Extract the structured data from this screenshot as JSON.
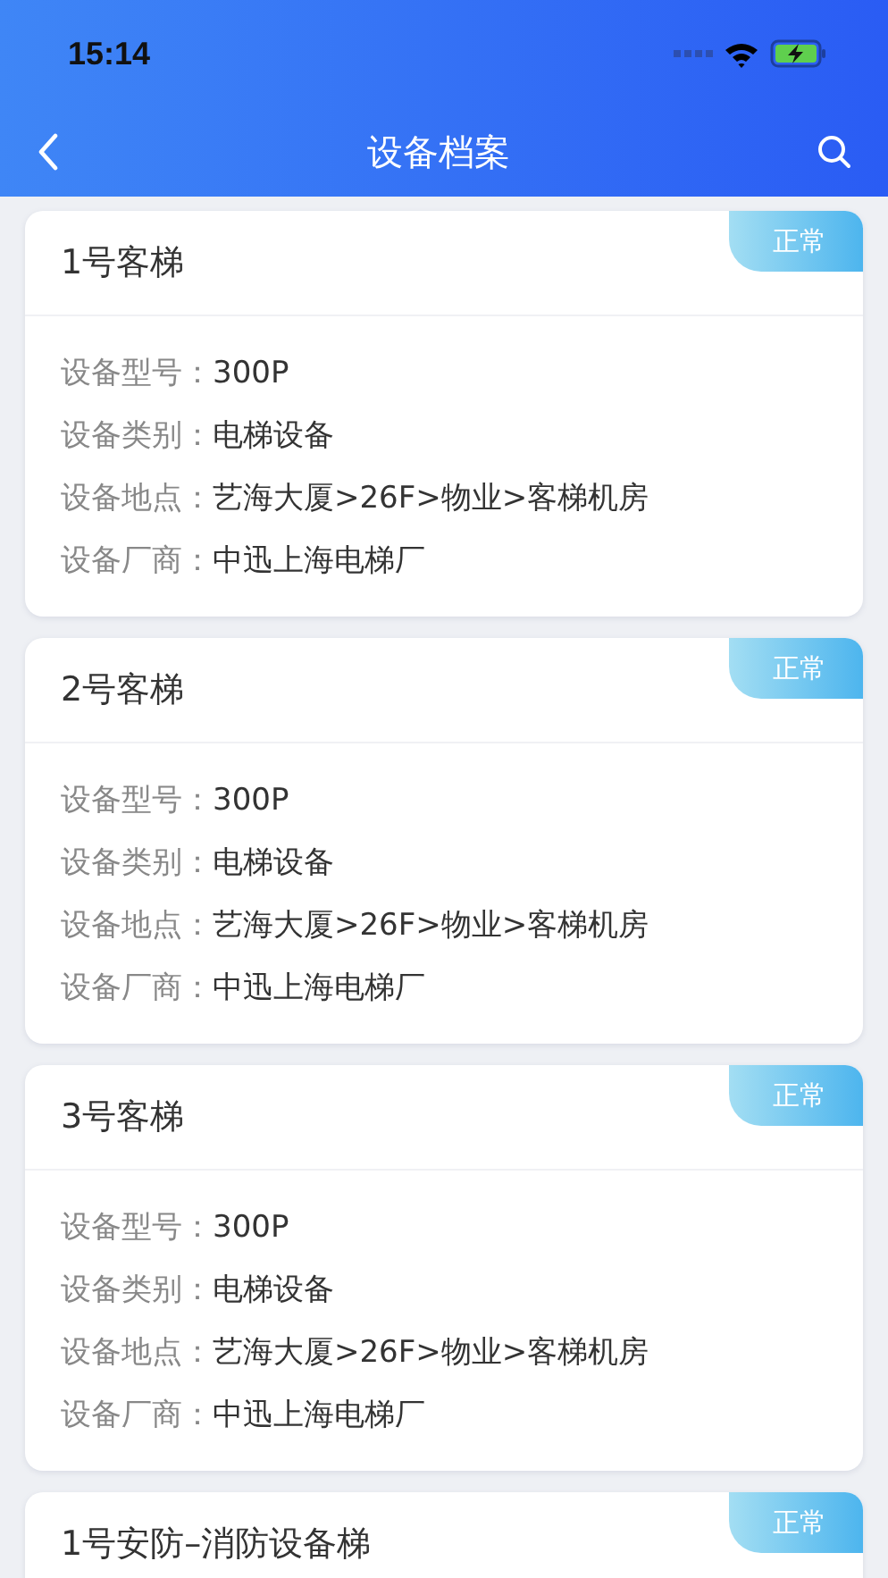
{
  "status_bar": {
    "time": "15:14"
  },
  "nav_bar": {
    "title": "设备档案"
  },
  "devices": [
    {
      "title": "1号客梯",
      "status": "正常",
      "fields": [
        {
          "label": "设备型号：",
          "value": "300P"
        },
        {
          "label": "设备类别：",
          "value": "电梯设备"
        },
        {
          "label": "设备地点：",
          "value": "艺海大厦>26F>物业>客梯机房"
        },
        {
          "label": "设备厂商：",
          "value": "中迅上海电梯厂"
        }
      ]
    },
    {
      "title": "2号客梯",
      "status": "正常",
      "fields": [
        {
          "label": "设备型号：",
          "value": "300P"
        },
        {
          "label": "设备类别：",
          "value": "电梯设备"
        },
        {
          "label": "设备地点：",
          "value": "艺海大厦>26F>物业>客梯机房"
        },
        {
          "label": "设备厂商：",
          "value": "中迅上海电梯厂"
        }
      ]
    },
    {
      "title": "3号客梯",
      "status": "正常",
      "fields": [
        {
          "label": "设备型号：",
          "value": "300P"
        },
        {
          "label": "设备类别：",
          "value": "电梯设备"
        },
        {
          "label": "设备地点：",
          "value": "艺海大厦>26F>物业>客梯机房"
        },
        {
          "label": "设备厂商：",
          "value": "中迅上海电梯厂"
        }
      ]
    },
    {
      "title": "1号安防–消防设备梯",
      "status": "正常"
    }
  ]
}
